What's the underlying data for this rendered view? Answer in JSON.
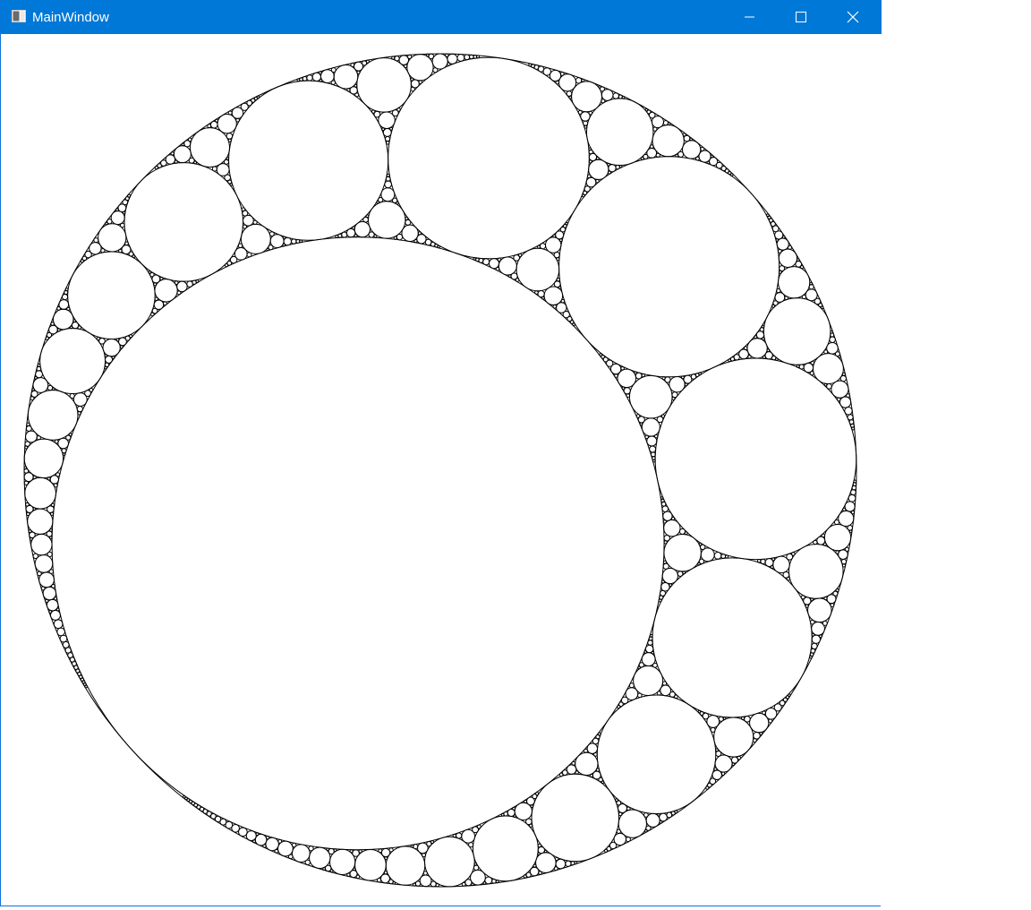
{
  "window": {
    "title": "MainWindow",
    "accent_color": "#0078d7",
    "icons": {
      "app": "window-app-icon",
      "minimize": "minimize-icon",
      "maximize": "maximize-icon",
      "close": "close-icon"
    }
  }
}
